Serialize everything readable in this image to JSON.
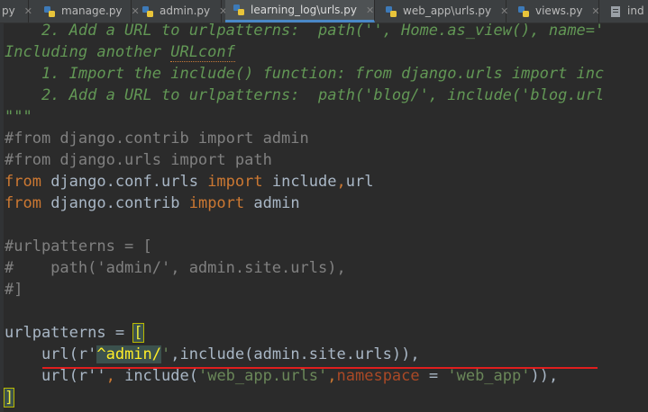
{
  "tabs": [
    {
      "label": "py",
      "active": false,
      "has_icon": false
    },
    {
      "label": "manage.py",
      "active": false,
      "has_icon": true
    },
    {
      "label": "admin.py",
      "active": false,
      "has_icon": true
    },
    {
      "label": "learning_log\\urls.py",
      "active": true,
      "has_icon": true
    },
    {
      "label": "web_app\\urls.py",
      "active": false,
      "has_icon": true
    },
    {
      "label": "views.py",
      "active": false,
      "has_icon": true
    },
    {
      "label": "ind",
      "active": false,
      "has_icon": true
    }
  ],
  "code": {
    "l1": "    2. Add a URL to urlpatterns:  path('', Home.as_view(), name='",
    "l2a": "Including another ",
    "l2b": "URLconf",
    "l3": "    1. Import the include() function: from django.urls import inc",
    "l4": "    2. Add a URL to urlpatterns:  path('blog/', include('blog.url",
    "l5": "\"\"\"",
    "l6": "#from django.contrib import admin",
    "l7": "#from django.urls import path",
    "l8_from": "from",
    "l8_mod": " django.conf.urls ",
    "l8_import": "import",
    "l8_names": " include",
    "l8_comma": ",",
    "l8_url": "url",
    "l9_from": "from",
    "l9_mod": " django.contrib ",
    "l9_import": "import",
    "l9_names": " admin",
    "l11": "#urlpatterns = [",
    "l12": "#    path('admin/', admin.site.urls),",
    "l13": "#]",
    "l15_name": "urlpatterns = ",
    "l15_br": "[",
    "l16_a": "    url(r'",
    "l16_caret": "^admin/",
    "l16_b": "'",
    "l16_c": ",include(admin.site.urls)),",
    "l17_a": "    url(r''",
    "l17_b": ", ",
    "l17_c": "include(",
    "l17_d": "'web_app.urls'",
    "l17_e": ",",
    "l17_f": "namespace",
    "l17_g": " = ",
    "l17_h": "'web_app'",
    "l17_i": ")),",
    "l18": "]"
  },
  "colors": {
    "background": "#2b2b2b",
    "docstring": "#629755",
    "comment": "#808080",
    "keyword": "#cc7832",
    "string": "#6a8759",
    "error_underline": "#e01e1e"
  }
}
